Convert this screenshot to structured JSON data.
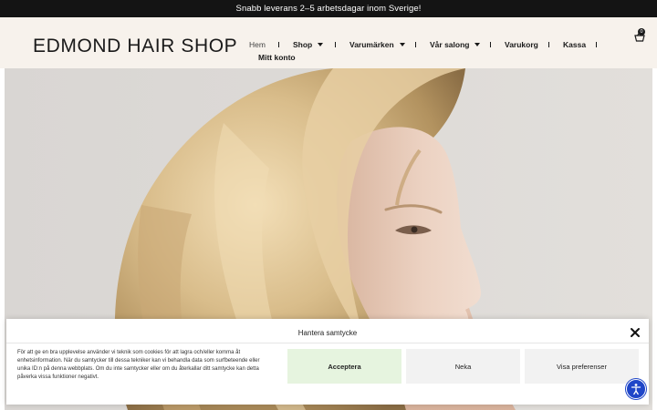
{
  "announcement": {
    "text": "Snabb leverans 2–5 arbetsdagar inom Sverige!"
  },
  "header": {
    "logo": "EDMOND HAIR SHOP",
    "nav": [
      {
        "label": "Hem",
        "active": true,
        "dropdown": false
      },
      {
        "label": "Shop",
        "active": false,
        "dropdown": true
      },
      {
        "label": "Varumärken",
        "active": false,
        "dropdown": true
      },
      {
        "label": "Vår salong",
        "active": false,
        "dropdown": true
      },
      {
        "label": "Varukorg",
        "active": false,
        "dropdown": false
      },
      {
        "label": "Kassa",
        "active": false,
        "dropdown": false
      },
      {
        "label": "Mitt konto",
        "active": false,
        "dropdown": false
      }
    ],
    "cart": {
      "icon": "shopping-basket-icon",
      "count": "0"
    }
  },
  "hero": {
    "slider_prev_icon": "chevron-left-icon",
    "slider_next_icon": "chevron-right-icon",
    "prev_glyph": "‹",
    "next_glyph": "›"
  },
  "cookie_banner": {
    "title": "Hantera samtycke",
    "body": "För att ge en bra upplevelse använder vi teknik som cookies för att lagra och/eller komma åt enhetsinformation. När du samtycker till dessa tekniker kan vi behandla data som surfbeteende eller unika ID:n på denna webbplats. Om du inte samtycker eller om du återkallar ditt samtycke kan detta påverka vissa funktioner negativt.",
    "accept_label": "Acceptera",
    "deny_label": "Neka",
    "preferences_label": "Visa preferenser",
    "close_icon": "close-icon"
  },
  "accessibility": {
    "icon": "accessibility-icon"
  },
  "colors": {
    "announce_bg": "#141414",
    "header_bg": "#f7f2ec",
    "accept_bg": "#e6f4df",
    "secondary_btn_bg": "#f2f2f2",
    "a11y_bg": "#1f46c8"
  }
}
